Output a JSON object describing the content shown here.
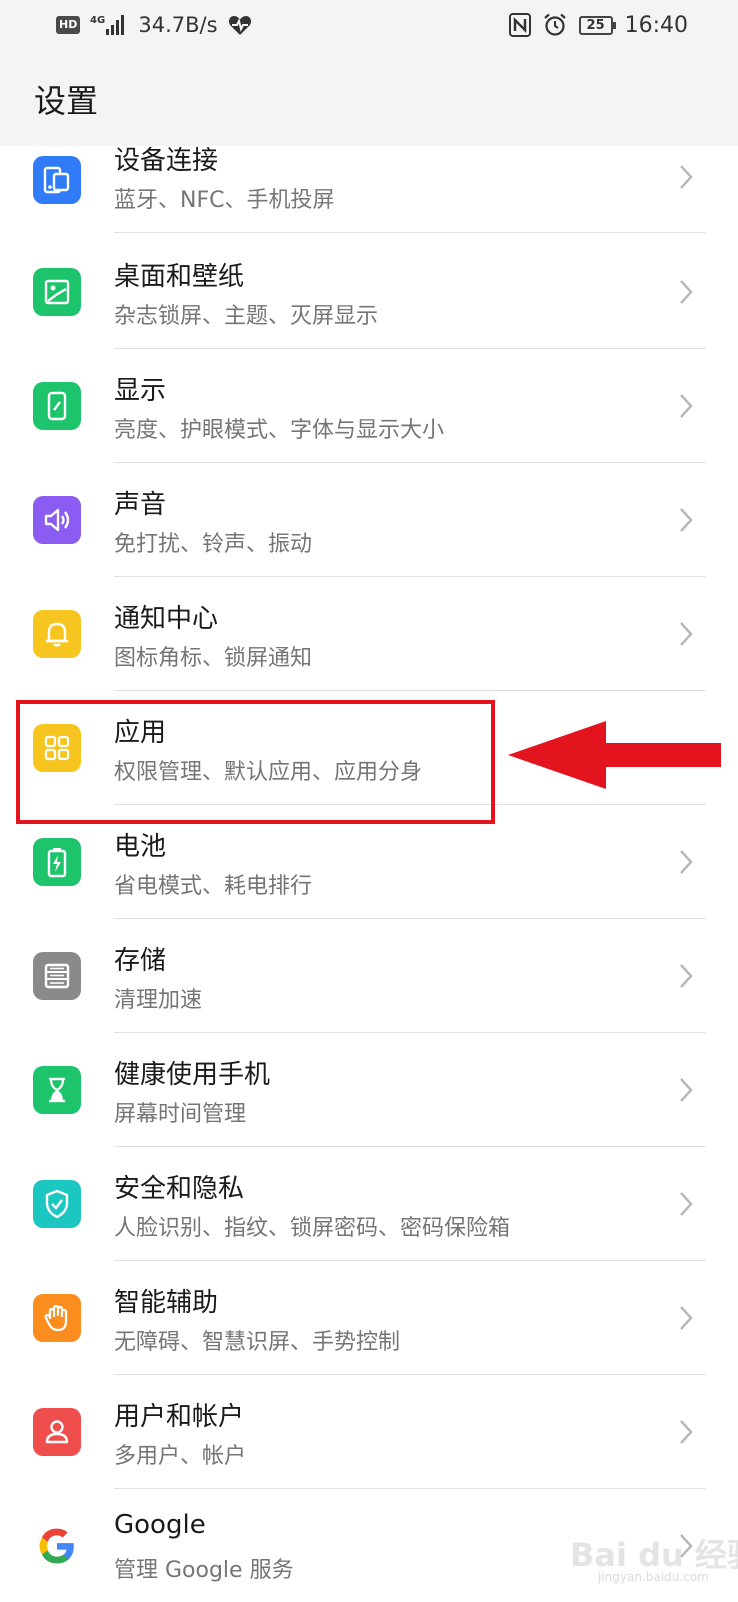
{
  "status_bar": {
    "hd": "HD",
    "network": "4G",
    "speed": "34.7B/s",
    "battery": "25",
    "time": "16:40",
    "icons": [
      "signal-icon",
      "heartbeat-icon",
      "nfc-icon",
      "alarm-icon",
      "battery-icon"
    ]
  },
  "header": {
    "title": "设置"
  },
  "settings": [
    {
      "title": "设备连接",
      "subtitle": "蓝牙、NFC、手机投屏",
      "icon": "device-connection-icon",
      "color": "#2f7cf6"
    },
    {
      "title": "桌面和壁纸",
      "subtitle": "杂志锁屏、主题、灭屏显示",
      "icon": "wallpaper-icon",
      "color": "#1ec46b"
    },
    {
      "title": "显示",
      "subtitle": "亮度、护眼模式、字体与显示大小",
      "icon": "display-icon",
      "color": "#1ec46b"
    },
    {
      "title": "声音",
      "subtitle": "免打扰、铃声、振动",
      "icon": "sound-icon",
      "color": "#8a5cf2"
    },
    {
      "title": "通知中心",
      "subtitle": "图标角标、锁屏通知",
      "icon": "bell-icon",
      "color": "#f7c51f"
    },
    {
      "title": "应用",
      "subtitle": "权限管理、默认应用、应用分身",
      "icon": "apps-grid-icon",
      "color": "#f7c51f"
    },
    {
      "title": "电池",
      "subtitle": "省电模式、耗电排行",
      "icon": "battery-charging-icon",
      "color": "#1ec46b"
    },
    {
      "title": "存储",
      "subtitle": "清理加速",
      "icon": "storage-icon",
      "color": "#8a8a8a"
    },
    {
      "title": "健康使用手机",
      "subtitle": "屏幕时间管理",
      "icon": "hourglass-icon",
      "color": "#1ec46b"
    },
    {
      "title": "安全和隐私",
      "subtitle": "人脸识别、指纹、锁屏密码、密码保险箱",
      "icon": "shield-icon",
      "color": "#1cc7c1"
    },
    {
      "title": "智能辅助",
      "subtitle": "无障碍、智慧识屏、手势控制",
      "icon": "hand-icon",
      "color": "#fb8c1e"
    },
    {
      "title": "用户和帐户",
      "subtitle": "多用户、帐户",
      "icon": "user-icon",
      "color": "#f04d4d"
    },
    {
      "title": "Google",
      "subtitle": "管理 Google 服务",
      "icon": "google-icon",
      "color": "#ffffff"
    }
  ],
  "annotation": {
    "highlight_color": "#e3141e"
  },
  "watermark": {
    "main": "Bai du 经验",
    "sub": "jingyan.baidu.com"
  }
}
